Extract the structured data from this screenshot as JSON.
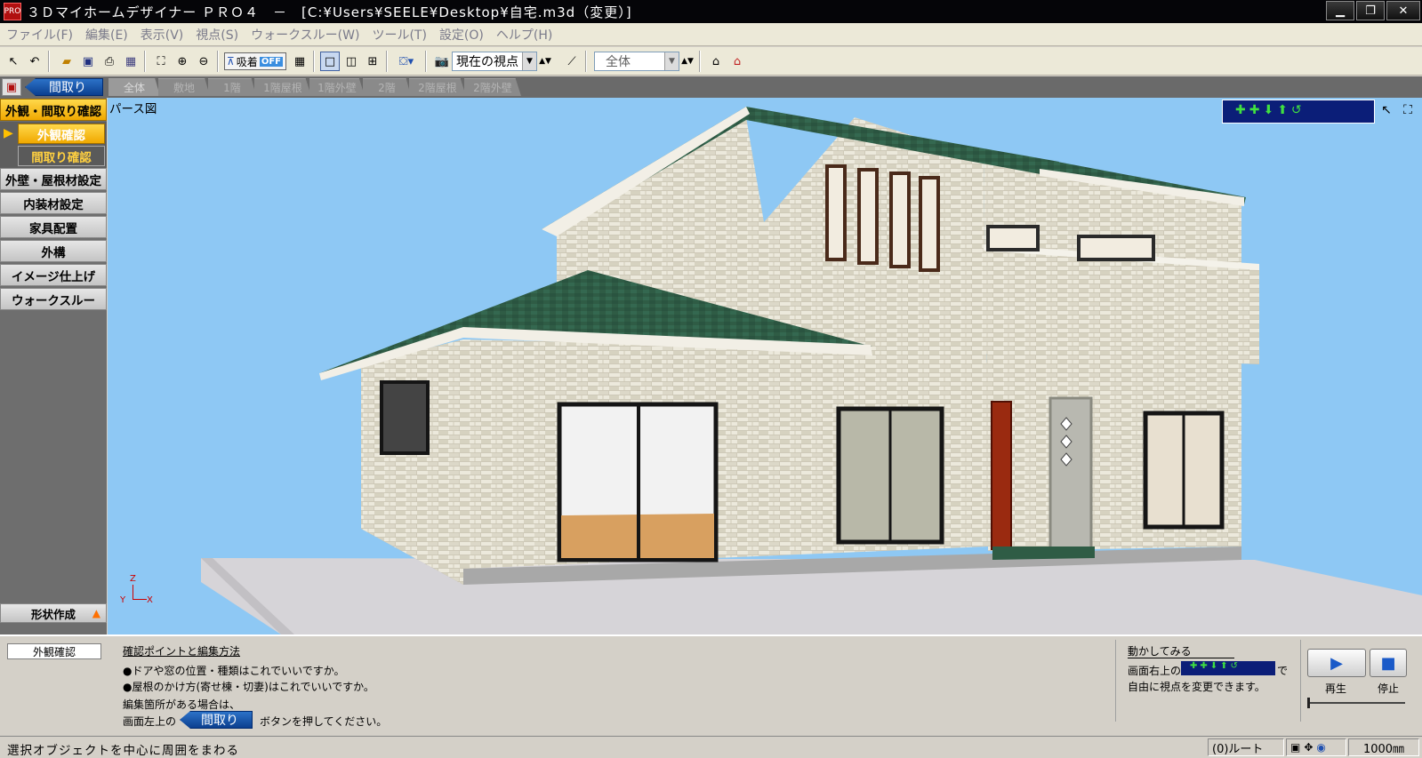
{
  "window": {
    "title": "３Ｄマイホームデザイナー ＰＲＯ４　－　[C:¥Users¥SEELE¥Desktop¥自宅.m3d（変更）]",
    "app_icon_text": "PRO"
  },
  "menu": [
    "ファイル(F)",
    "編集(E)",
    "表示(V)",
    "視点(S)",
    "ウォークスルー(W)",
    "ツール(T)",
    "設定(O)",
    "ヘルプ(H)"
  ],
  "toolbar": {
    "snap_label": "吸着",
    "snap_state": "OFF",
    "viewpoint_value": "現在の視点",
    "scope_value": "全体"
  },
  "tabs": {
    "madori_button": "間取り",
    "floor_tabs": [
      "全体",
      "敷地",
      "1階",
      "1階屋根",
      "1階外壁",
      "2階",
      "2階屋根",
      "2階外壁"
    ],
    "active": "全体"
  },
  "sidebar": {
    "header": "外観・間取り確認",
    "sub_items": [
      "外観確認",
      "間取り確認"
    ],
    "items": [
      "外壁・屋根材設定",
      "内装材設定",
      "家具配置",
      "外構",
      "イメージ仕上げ",
      "ウォークスルー"
    ],
    "footer": "形状作成"
  },
  "viewport": {
    "label": "パース図",
    "axes": {
      "z": "Z",
      "y": "Y",
      "x": "X"
    }
  },
  "bottom": {
    "mode_box": "外観確認",
    "help_title": "確認ポイントと編集方法",
    "help_line1": "●ドアや窓の位置・種類はこれでいいですか。",
    "help_line2": "●屋根のかけ方(寄せ棟・切妻)はこれでいいですか。",
    "help_line3": "編集箇所がある場合は、",
    "help_line4a": "画面左上の",
    "help_line4_btn": "間取り",
    "help_line4b": "ボタンを押してください。",
    "move_title": "動かしてみる",
    "move_line1a": "画面右上の",
    "move_line1b": "で",
    "move_line2": "自由に視点を変更できます。",
    "play_label": "再生",
    "stop_label": "停止"
  },
  "status": {
    "message": "選択オブジェクトを中心に周囲をまわる",
    "route": "(0)ルート",
    "scale": "1000㎜"
  }
}
